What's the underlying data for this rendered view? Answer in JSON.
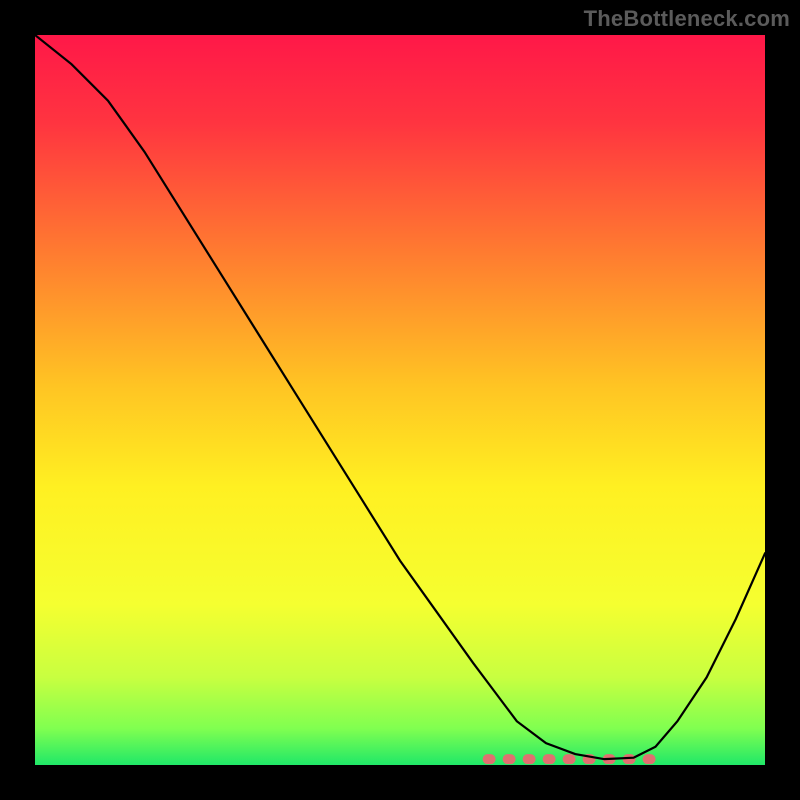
{
  "watermark": "TheBottleneck.com",
  "chart_data": {
    "type": "line",
    "title": "",
    "xlabel": "",
    "ylabel": "",
    "xlim": [
      0,
      100
    ],
    "ylim": [
      0,
      100
    ],
    "grid": false,
    "legend": false,
    "series": [
      {
        "name": "bottleneck-curve",
        "x": [
          0,
          5,
          10,
          15,
          20,
          25,
          30,
          35,
          40,
          45,
          50,
          55,
          60,
          63,
          66,
          70,
          74,
          78,
          82,
          85,
          88,
          92,
          96,
          100
        ],
        "y": [
          100,
          96,
          91,
          84,
          76,
          68,
          60,
          52,
          44,
          36,
          28,
          21,
          14,
          10,
          6,
          3,
          1.5,
          0.8,
          1,
          2.5,
          6,
          12,
          20,
          29
        ]
      }
    ],
    "annotations": [
      {
        "name": "pink-dashed-minimum",
        "x_range": [
          62,
          86
        ],
        "y": 0.8
      }
    ],
    "background_gradient": {
      "stops": [
        {
          "offset": 0.0,
          "color": "#ff1848"
        },
        {
          "offset": 0.12,
          "color": "#ff3440"
        },
        {
          "offset": 0.3,
          "color": "#ff7c30"
        },
        {
          "offset": 0.48,
          "color": "#ffc423"
        },
        {
          "offset": 0.62,
          "color": "#fff022"
        },
        {
          "offset": 0.78,
          "color": "#f5ff30"
        },
        {
          "offset": 0.88,
          "color": "#c8ff40"
        },
        {
          "offset": 0.95,
          "color": "#80ff50"
        },
        {
          "offset": 1.0,
          "color": "#20e868"
        }
      ]
    }
  }
}
